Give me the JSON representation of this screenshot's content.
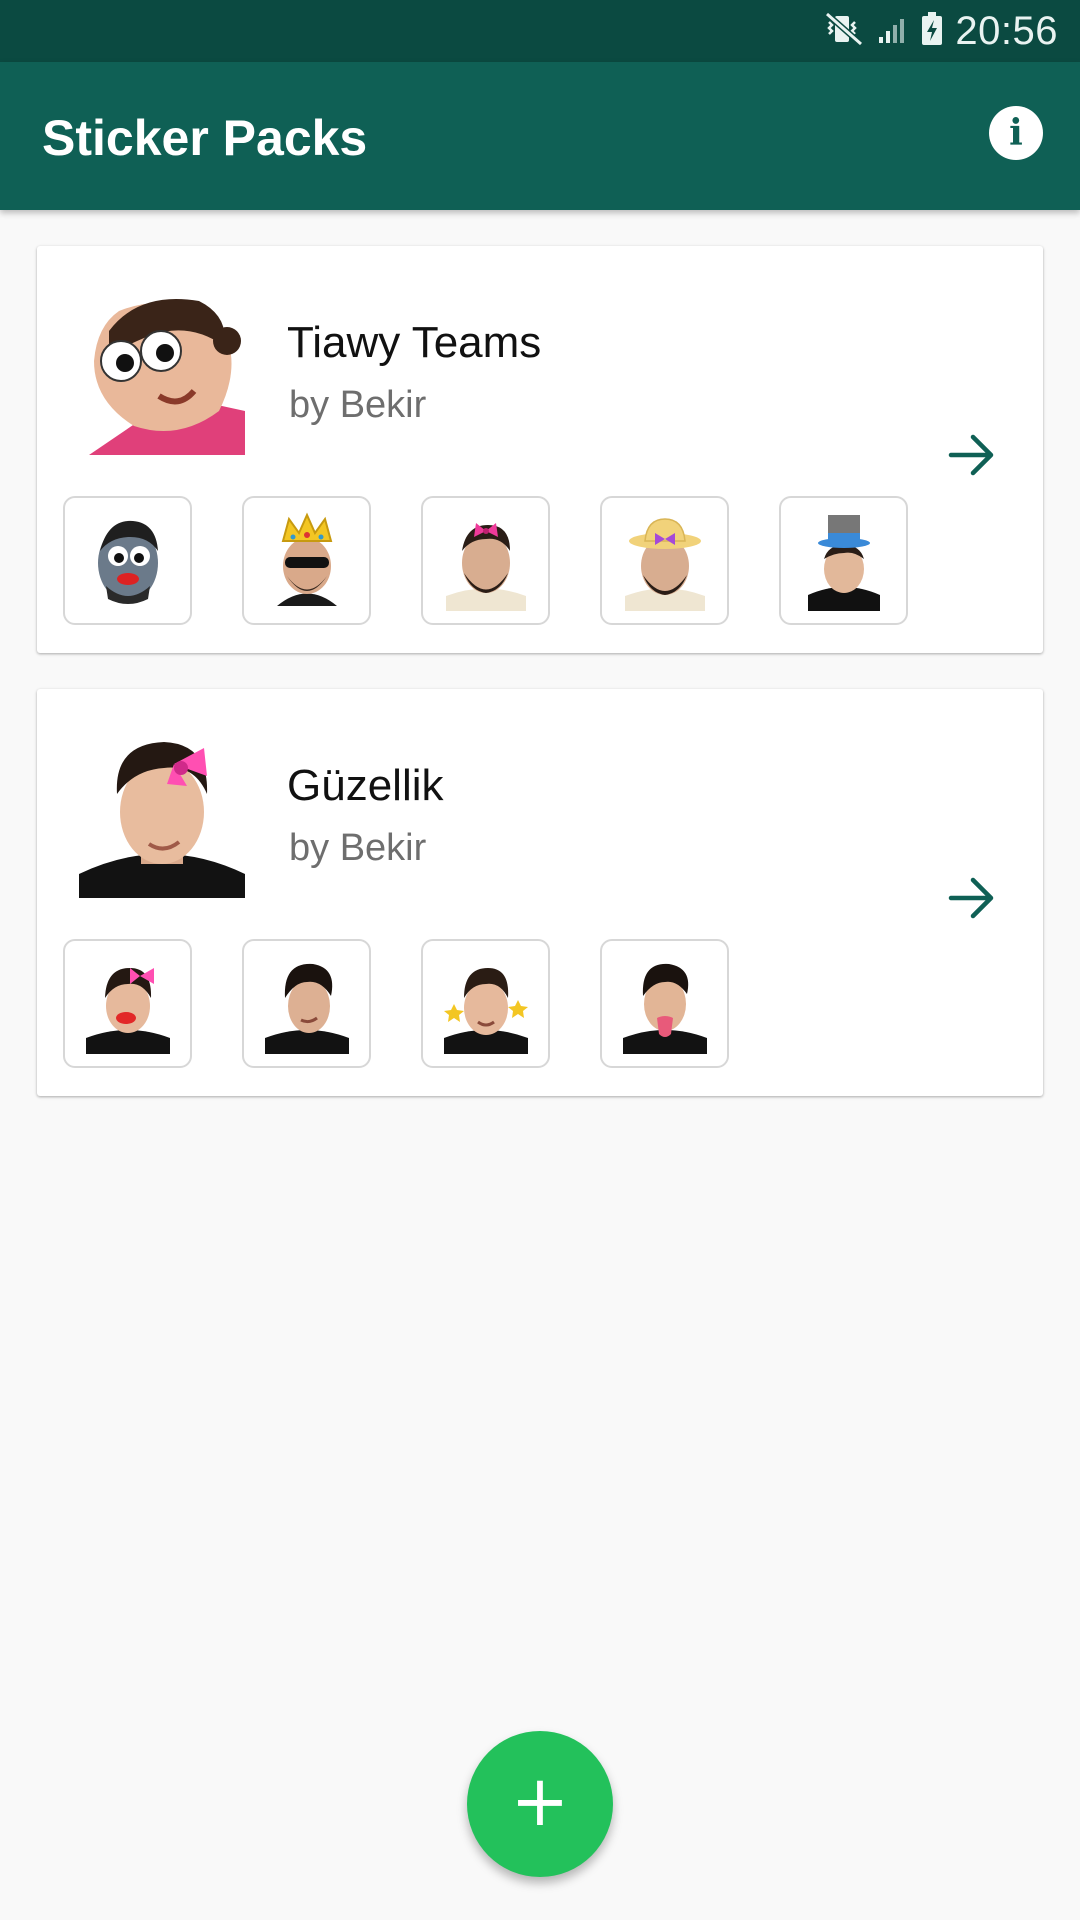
{
  "status_bar": {
    "time": "20:56",
    "icons": [
      "vibrate-mute-icon",
      "signal-icon",
      "battery-charging-icon"
    ]
  },
  "app_bar": {
    "title": "Sticker Packs",
    "action_icon": "info-icon",
    "action_glyph": "i"
  },
  "packs": [
    {
      "name": "Tiawy Teams",
      "publisher": "by Bekir",
      "tray_icon": "googly-eyes-baby-sticker",
      "previews": [
        "face-googly-lips-sticker",
        "crown-sunglasses-sticker",
        "pink-bow-sticker",
        "sunhat-sticker",
        "top-hat-sticker"
      ]
    },
    {
      "name": "Güzellik",
      "publisher": "by Bekir",
      "tray_icon": "pink-bow-man-sticker",
      "previews": [
        "bow-lips-sticker",
        "dark-hair-sticker",
        "dizzy-stars-sticker",
        "tongue-out-sticker"
      ]
    }
  ],
  "fab": {
    "label": "+",
    "icon": "add-icon"
  },
  "colors": {
    "status_bar": "#0b4a41",
    "app_bar": "#0f6055",
    "accent": "#0f6055",
    "fab": "#23c15b",
    "background": "#f9f9f9"
  }
}
